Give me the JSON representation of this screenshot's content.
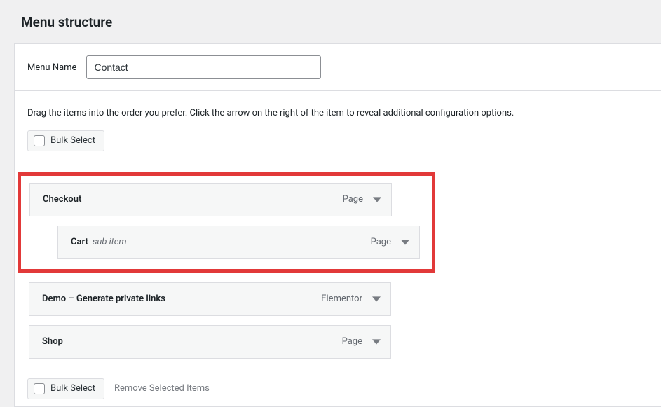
{
  "header": {
    "title": "Menu structure"
  },
  "menuName": {
    "label": "Menu Name",
    "value": "Contact"
  },
  "instructions": "Drag the items into the order you prefer. Click the arrow on the right of the item to reveal additional configuration options.",
  "bulk": {
    "label": "Bulk Select",
    "removeLabel": "Remove Selected Items"
  },
  "menuItems": {
    "checkout": {
      "title": "Checkout",
      "type": "Page"
    },
    "cart": {
      "title": "Cart",
      "subtitle": "sub item",
      "type": "Page"
    },
    "demo": {
      "title": "Demo – Generate private links",
      "type": "Elementor"
    },
    "shop": {
      "title": "Shop",
      "type": "Page"
    }
  }
}
